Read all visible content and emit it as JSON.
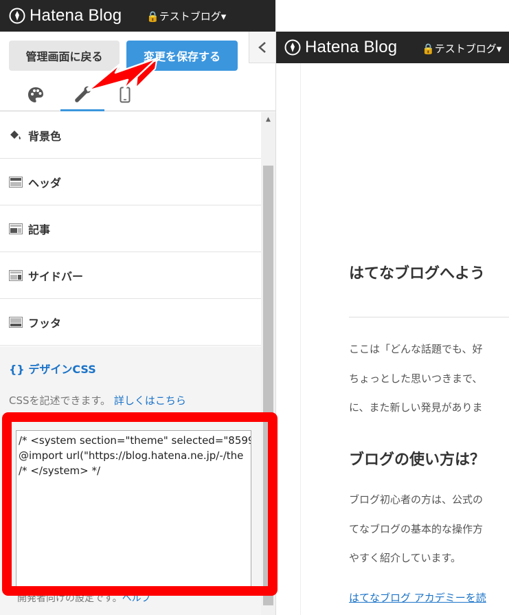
{
  "topbar": {
    "brand": "Hatena Blog",
    "blog_selector": "テストブログ▾"
  },
  "sidebar": {
    "back_button": "管理画面に戻る",
    "save_button": "変更を保存する",
    "collapse_icon": "chevron-left-icon",
    "tabs": [
      {
        "name": "design",
        "icon": "palette-icon"
      },
      {
        "name": "customize",
        "icon": "wrench-icon",
        "active": true
      },
      {
        "name": "smartphone",
        "icon": "smartphone-icon"
      }
    ],
    "items": [
      {
        "label": "背景色",
        "icon": "paint-bucket-icon"
      },
      {
        "label": "ヘッダ",
        "icon": "header-layout-icon"
      },
      {
        "label": "記事",
        "icon": "article-layout-icon"
      },
      {
        "label": "サイドバー",
        "icon": "sidebar-layout-icon"
      },
      {
        "label": "フッタ",
        "icon": "footer-layout-icon"
      }
    ],
    "css_section": {
      "title": "{} デザインCSS",
      "description": "CSSを記述できます。",
      "help_link": "詳しくはこちら",
      "editor_value": "/* <system section=\"theme\" selected=\"8599\n@import url(\"https://blog.hatena.ne.jp/-/the\n/* </system> */",
      "dev_note": "開発者向けの設定です。",
      "dev_note_link": "ヘルプ"
    }
  },
  "preview": {
    "brand": "Hatena Blog",
    "blog_selector": "テストブログ▾",
    "heading1": "はてなブログへよう",
    "para1_line1": "ここは「どんな話題でも、好",
    "para1_line2": "ちょっとした思いつきまで、",
    "para1_line3": "に、また新しい発見がありま",
    "heading2": "ブログの使い方は？",
    "para2_line1": "ブログ初心者の方は、公式の",
    "para2_line2": "てなブログの基本的な操作方",
    "para2_line3": "やすく紹介しています。",
    "link": "はてなブログ アカデミーを読"
  },
  "colors": {
    "topbar_bg": "#262626",
    "accent": "#3b96de",
    "annotation": "#ff0000"
  }
}
